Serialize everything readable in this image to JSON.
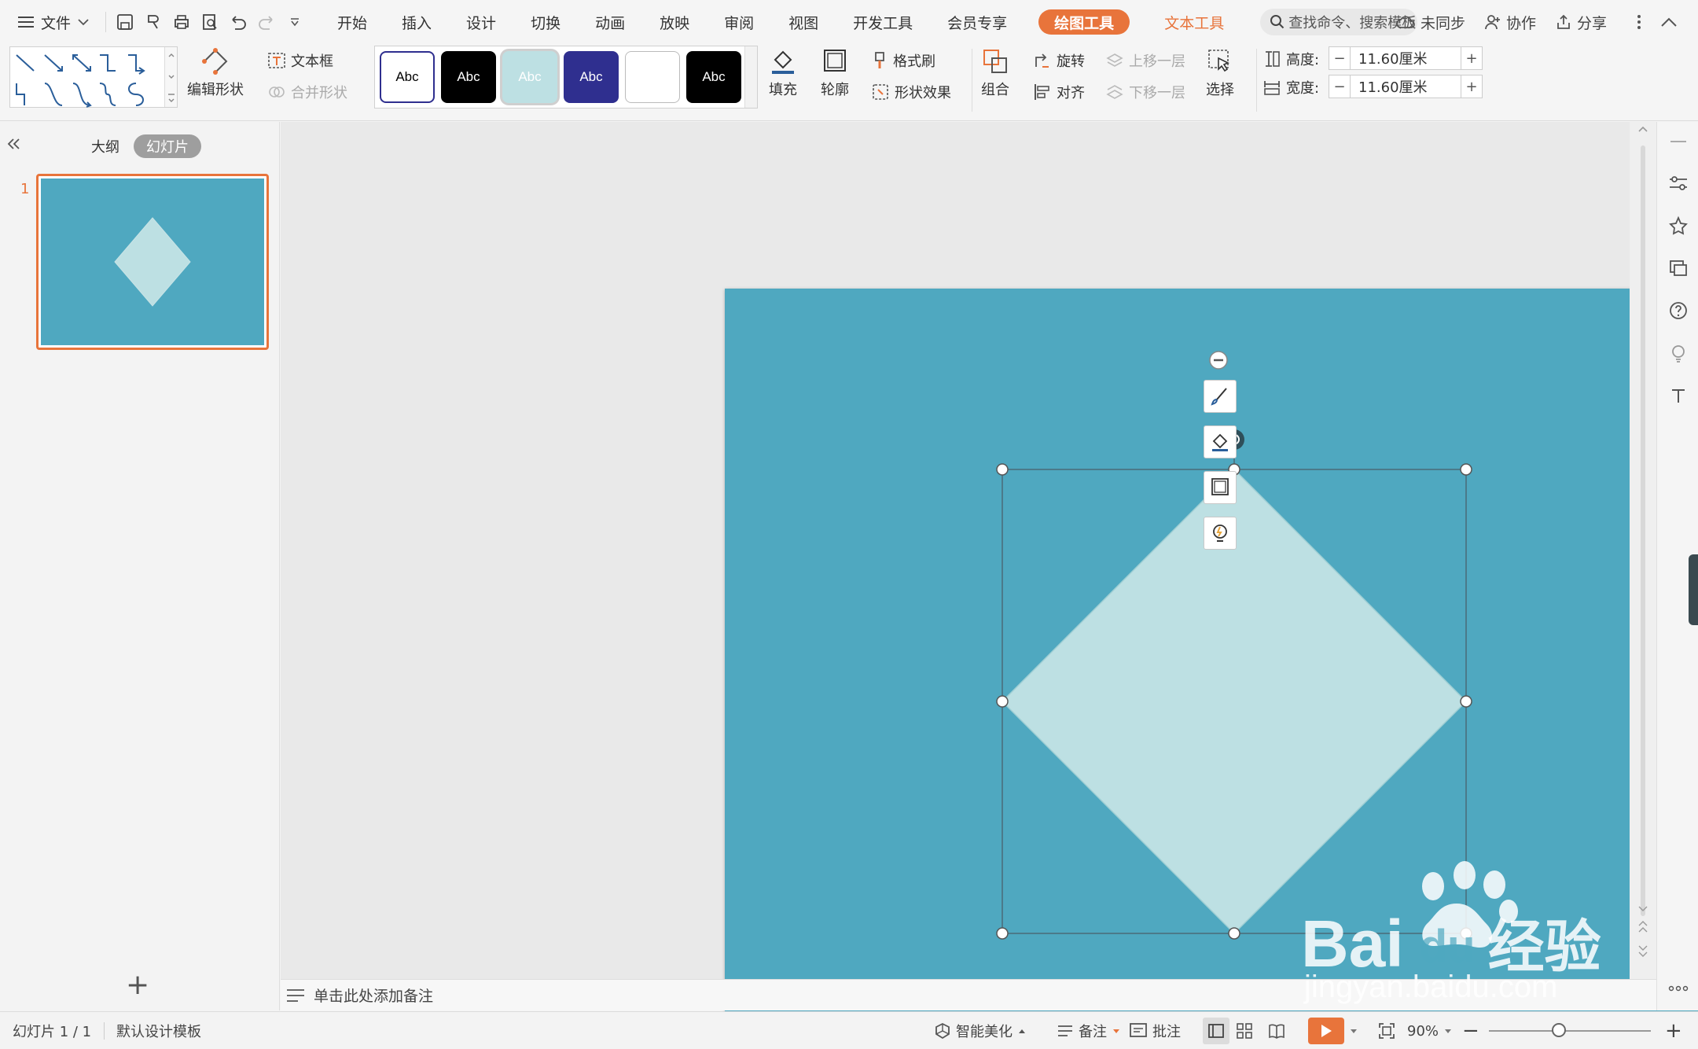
{
  "menubar": {
    "file_label": "文件",
    "tabs": [
      "开始",
      "插入",
      "设计",
      "切换",
      "动画",
      "放映",
      "审阅",
      "视图",
      "开发工具",
      "会员专享"
    ],
    "drawing_tools": "绘图工具",
    "text_tools": "文本工具",
    "search_placeholder": "查找命令、搜索模板",
    "sync": "未同步",
    "collab": "协作",
    "share": "分享"
  },
  "ribbon": {
    "edit_shape": "编辑形状",
    "text_box": "文本框",
    "merge_shape": "合并形状",
    "style_label": "Abc",
    "fill": "填充",
    "outline": "轮廓",
    "format_painter": "格式刷",
    "shape_effect": "形状效果",
    "group": "组合",
    "rotate": "旋转",
    "align": "对齐",
    "bring_forward": "上移一层",
    "send_backward": "下移一层",
    "select": "选择",
    "height_label": "高度:",
    "height_value": "11.60厘米",
    "width_label": "宽度:",
    "width_value": "11.60厘米",
    "minus": "−",
    "plus": "+"
  },
  "leftpanel": {
    "outline_tab": "大纲",
    "slides_tab": "幻灯片",
    "slide_number": "1",
    "add": "+"
  },
  "notes": {
    "placeholder": "单击此处添加备注"
  },
  "statusbar": {
    "slide_info": "幻灯片 1 / 1",
    "template": "默认设计模板",
    "beautify": "智能美化",
    "notes": "备注",
    "comments": "批注",
    "zoom": "90%",
    "zoom_minus": "−",
    "zoom_plus": "+"
  },
  "watermark": {
    "brand": "Bai",
    "brand_du": "du",
    "brand_cn": "经验",
    "url": "jingyan.baidu.com"
  },
  "colors": {
    "slide_bg": "#4fa8c0",
    "diamond_fill": "#bde0e3",
    "accent_orange": "#e8743b",
    "style_navy": "#2f2f8f"
  }
}
